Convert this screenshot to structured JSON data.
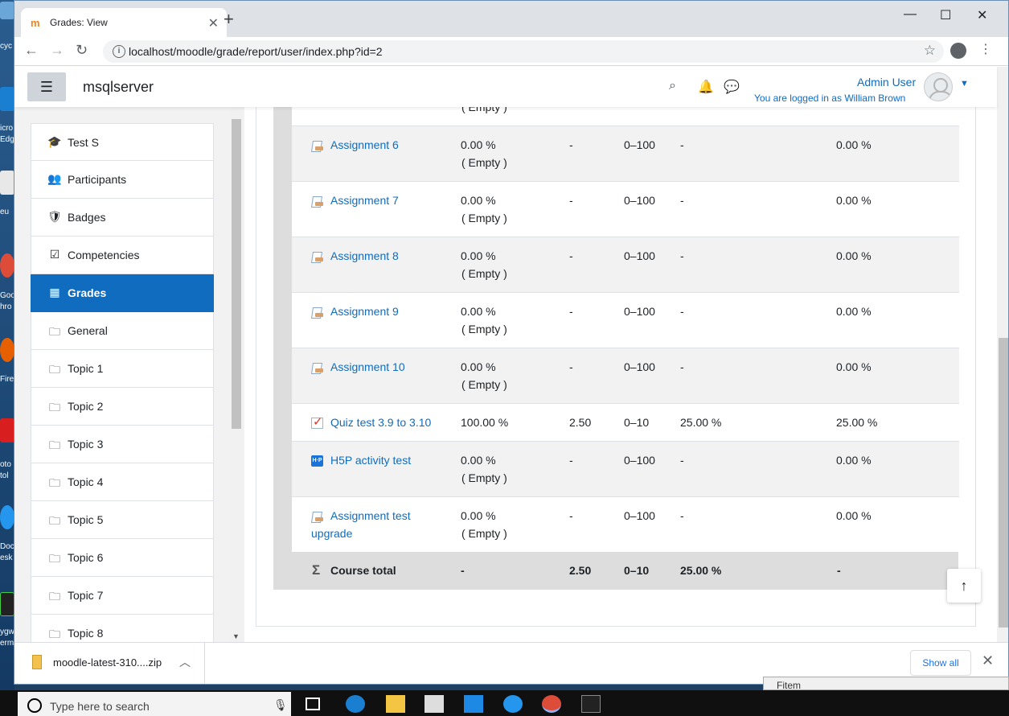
{
  "desktop": {
    "labels": [
      "cyc",
      "icro",
      "Edg",
      "eu",
      "Goo",
      "hro",
      "Fire",
      "oto",
      "tol",
      "Doc",
      "esk",
      "ygw",
      "erm"
    ]
  },
  "browser": {
    "tab_title": "Grades: View",
    "url": "localhost/moodle/grade/report/user/index.php?id=2",
    "colors": {
      "accent": "#0f6cbf",
      "tab_bg": "#dee1e6"
    }
  },
  "navbar": {
    "site_name": "msqlserver",
    "user_name": "Admin User",
    "logged_in_as": "You are logged in as William Brown"
  },
  "drawer": {
    "items": [
      {
        "label": "Test S",
        "icon": "graduation-cap-icon",
        "glyph": "🎓",
        "active": false
      },
      {
        "label": "Participants",
        "icon": "users-icon",
        "glyph": "👥",
        "active": false
      },
      {
        "label": "Badges",
        "icon": "shield-icon",
        "glyph": "🛡",
        "active": false
      },
      {
        "label": "Competencies",
        "icon": "checkbox-icon",
        "glyph": "☑",
        "active": false
      },
      {
        "label": "Grades",
        "icon": "table-icon",
        "glyph": "▦",
        "active": true
      },
      {
        "label": "General",
        "icon": "folder-icon",
        "glyph": "🗀",
        "active": false
      },
      {
        "label": "Topic 1",
        "icon": "folder-icon",
        "glyph": "🗀",
        "active": false
      },
      {
        "label": "Topic 2",
        "icon": "folder-icon",
        "glyph": "🗀",
        "active": false
      },
      {
        "label": "Topic 3",
        "icon": "folder-icon",
        "glyph": "🗀",
        "active": false
      },
      {
        "label": "Topic 4",
        "icon": "folder-icon",
        "glyph": "🗀",
        "active": false
      },
      {
        "label": "Topic 5",
        "icon": "folder-icon",
        "glyph": "🗀",
        "active": false
      },
      {
        "label": "Topic 6",
        "icon": "folder-icon",
        "glyph": "🗀",
        "active": false
      },
      {
        "label": "Topic 7",
        "icon": "folder-icon",
        "glyph": "🗀",
        "active": false
      },
      {
        "label": "Topic 8",
        "icon": "folder-icon",
        "glyph": "🗀",
        "active": false
      }
    ]
  },
  "grades": {
    "partial_top_text": "( Empty )",
    "rows": [
      {
        "name": "Assignment 6",
        "icon": "assignment-icon",
        "grade": "0.00 %",
        "grade_note": "( Empty )",
        "points": "-",
        "range": "0–100",
        "percentage": "-",
        "contribution": "0.00 %"
      },
      {
        "name": "Assignment 7",
        "icon": "assignment-icon",
        "grade": "0.00 %",
        "grade_note": "( Empty )",
        "points": "-",
        "range": "0–100",
        "percentage": "-",
        "contribution": "0.00 %"
      },
      {
        "name": "Assignment 8",
        "icon": "assignment-icon",
        "grade": "0.00 %",
        "grade_note": "( Empty )",
        "points": "-",
        "range": "0–100",
        "percentage": "-",
        "contribution": "0.00 %"
      },
      {
        "name": "Assignment 9",
        "icon": "assignment-icon",
        "grade": "0.00 %",
        "grade_note": "( Empty )",
        "points": "-",
        "range": "0–100",
        "percentage": "-",
        "contribution": "0.00 %"
      },
      {
        "name": "Assignment 10",
        "icon": "assignment-icon",
        "grade": "0.00 %",
        "grade_note": "( Empty )",
        "points": "-",
        "range": "0–100",
        "percentage": "-",
        "contribution": "0.00 %"
      },
      {
        "name": "Quiz test 3.9 to 3.10",
        "icon": "quiz-icon",
        "grade": "100.00 %",
        "grade_note": "",
        "points": "2.50",
        "range": "0–10",
        "percentage": "25.00 %",
        "contribution": "25.00 %"
      },
      {
        "name": "H5P activity test",
        "icon": "h5p-icon",
        "grade": "0.00 %",
        "grade_note": "( Empty )",
        "points": "-",
        "range": "0–100",
        "percentage": "-",
        "contribution": "0.00 %"
      },
      {
        "name": "Assignment test",
        "name_line2": "upgrade",
        "icon": "assignment-icon",
        "grade": "0.00 %",
        "grade_note": "( Empty )",
        "points": "-",
        "range": "0–100",
        "percentage": "-",
        "contribution": "0.00 %"
      }
    ],
    "total": {
      "name": "Course total",
      "grade": "-",
      "points": "2.50",
      "range": "0–10",
      "percentage": "25.00 %",
      "contribution": "-"
    }
  },
  "downloads": {
    "file_name": "moodle-latest-310....zip",
    "show_all_label": "Show all"
  },
  "taskbar": {
    "search_placeholder": "Type here to search"
  },
  "peek_window": {
    "text": "Fitem"
  }
}
